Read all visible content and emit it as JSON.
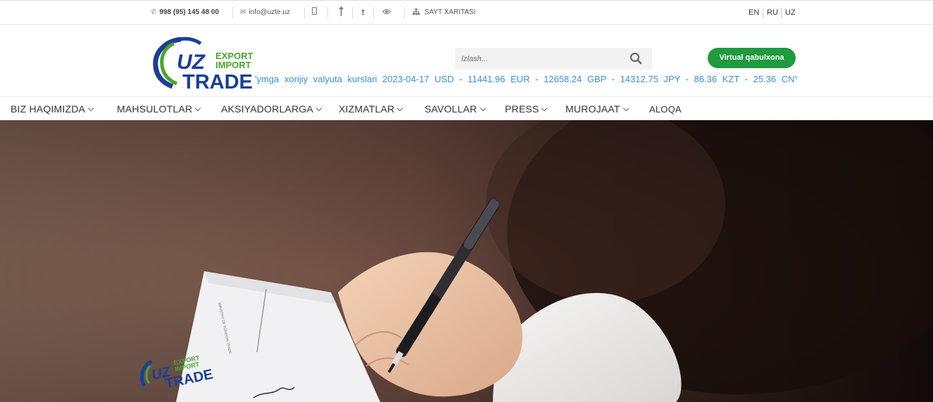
{
  "topbar": {
    "phone": "998 (95) 145 48 00",
    "email": "info@uzte.uz",
    "sitemap_label": "SAYT XARITASI",
    "icons": [
      "phone-icon",
      "mail-icon",
      "mobile-icon",
      "font-increase-icon",
      "font-decrease-icon",
      "eye-icon",
      "sitemap-icon"
    ],
    "languages": [
      "EN",
      "RU",
      "UZ"
    ]
  },
  "header": {
    "logo": {
      "line1": "UZ",
      "line2": "EXPORT",
      "line3": "IMPORT",
      "line4": "TRADE"
    },
    "search_placeholder": "Izlash...",
    "virtual_button": "Virtual qabulxona",
    "ticker_text": "'ymga xorijiy valyuta kurslari 2023-04-17 USD - 11441.96 EUR - 12658.24 GBP - 14312.75 JPY - 86.36 KZT - 25.36 CNY"
  },
  "nav": {
    "items": [
      {
        "label": "BIZ HAQIMIZDA",
        "has_dropdown": true
      },
      {
        "label": "MAHSULOTLAR",
        "has_dropdown": true
      },
      {
        "label": "AKSIYADORLARGA",
        "has_dropdown": true
      },
      {
        "label": "XIZMATLAR",
        "has_dropdown": true
      },
      {
        "label": "SAVOLLAR",
        "has_dropdown": true
      },
      {
        "label": "PRESS",
        "has_dropdown": true
      },
      {
        "label": "MUROJAAT",
        "has_dropdown": true
      },
      {
        "label": "ALOQA",
        "has_dropdown": false
      }
    ]
  },
  "hero": {
    "document_logo": {
      "line1": "UZ",
      "line2": "EXPORT",
      "line3": "IMPORT",
      "line4": "TRADE"
    }
  },
  "colors": {
    "brand_blue": "#1b3f96",
    "brand_green": "#4aa52e",
    "button_green": "#1f9a3f",
    "ticker_blue": "#3a8fd6"
  }
}
